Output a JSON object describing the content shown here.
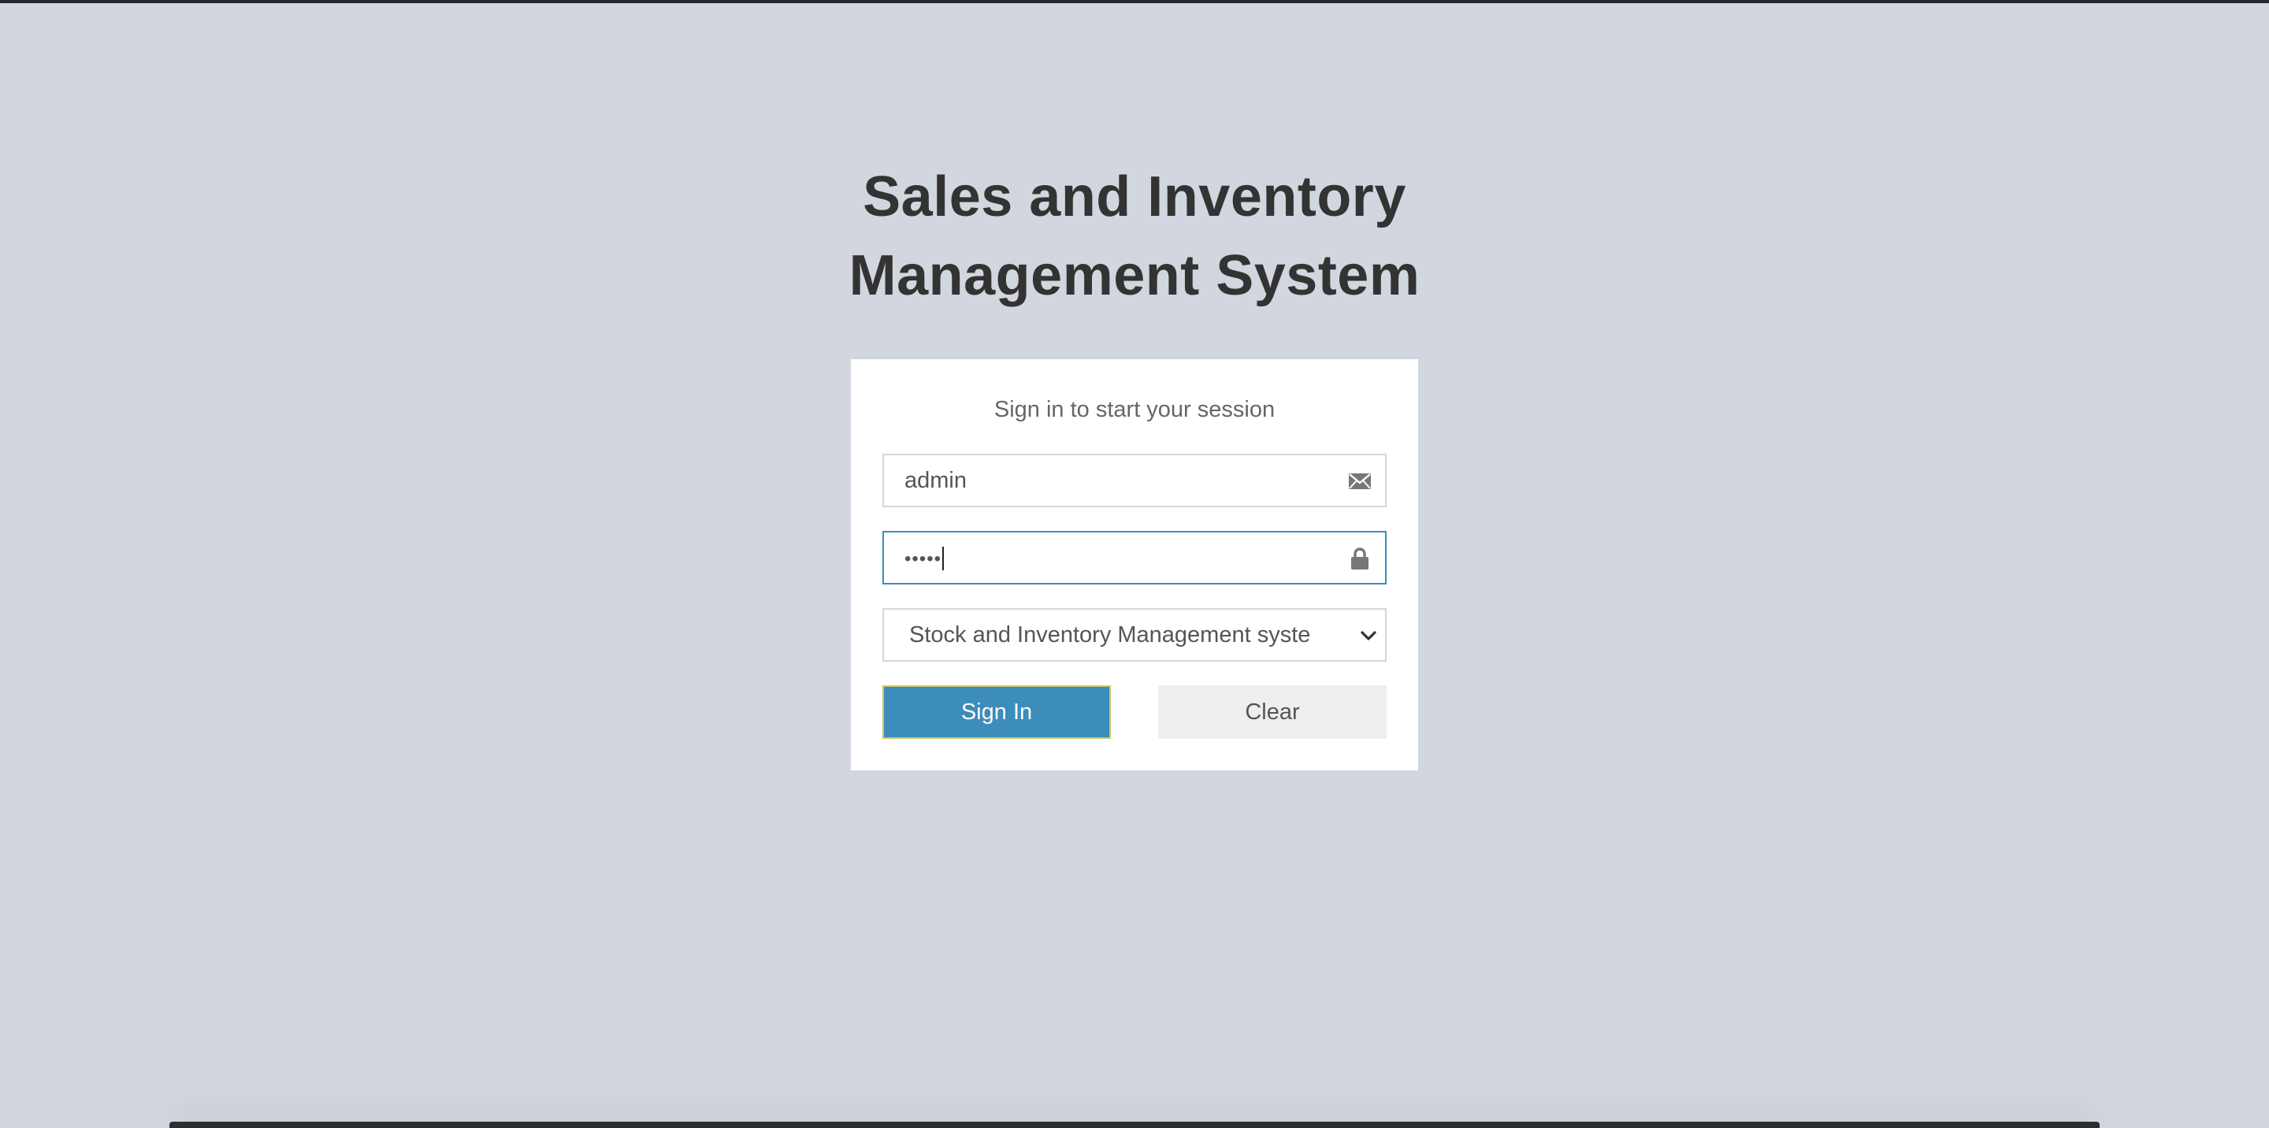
{
  "title": {
    "line1": "Sales and Inventory",
    "line2": "Management System"
  },
  "login": {
    "message": "Sign in to start your session",
    "username_value": "admin",
    "username_icon": "envelope-icon",
    "password_value": "•••••",
    "password_icon": "lock-icon",
    "system_select_value": "Stock and Inventory Management syste",
    "sign_in_label": "Sign In",
    "clear_label": "Clear"
  },
  "colors": {
    "background": "#d2d6de",
    "primary": "#3c8dbc",
    "focus_border": "#3c8dbc"
  }
}
